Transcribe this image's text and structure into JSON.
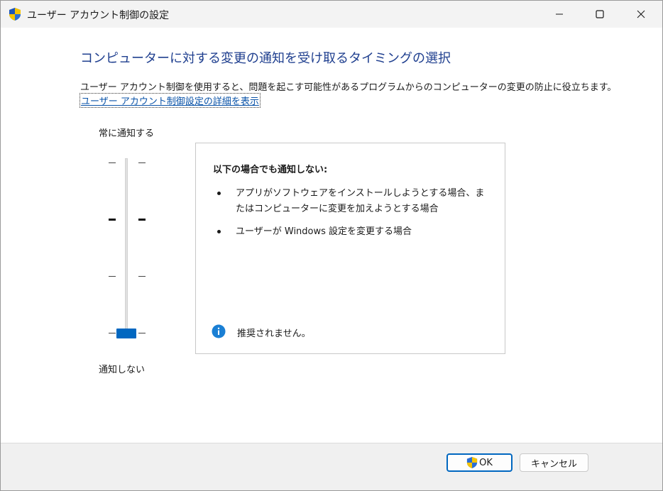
{
  "window": {
    "title": "ユーザー アカウント制御の設定"
  },
  "main": {
    "heading": "コンピューターに対する変更の通知を受け取るタイミングの選択",
    "description": "ユーザー アカウント制御を使用すると、問題を起こす可能性があるプログラムからのコンピューターの変更の防止に役立ちます。",
    "details_link": "ユーザー アカウント制御設定の詳細を表示"
  },
  "slider": {
    "top_label": "常に通知する",
    "bottom_label": "通知しない",
    "levels": 4,
    "selected_level": 1
  },
  "panel": {
    "title": "以下の場合でも通知しない:",
    "bullets": [
      "アプリがソフトウェアをインストールしようとする場合、またはコンピューターに変更を加えようとする場合",
      "ユーザーが Windows 設定を変更する場合"
    ],
    "note": "推奨されません。"
  },
  "footer": {
    "ok_label": "OK",
    "cancel_label": "キャンセル"
  },
  "colors": {
    "accent": "#0067c0",
    "heading": "#1f3f8f",
    "link": "#0a53a8",
    "info": "#1a7fd4"
  }
}
